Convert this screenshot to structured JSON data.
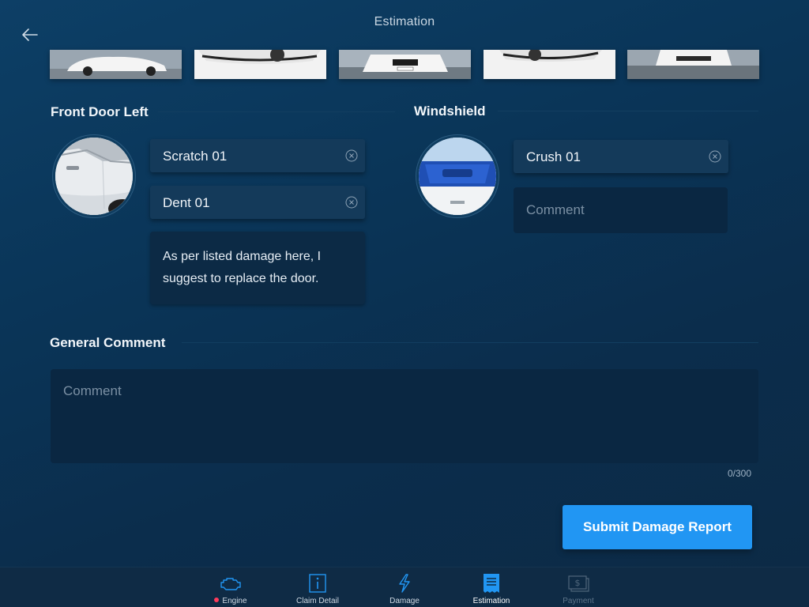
{
  "header": {
    "title": "Estimation"
  },
  "sections": {
    "front_door": {
      "title": "Front Door Left",
      "tags": [
        "Scratch 01",
        "Dent 01"
      ],
      "note": "As per listed damage here, I suggest to replace the door."
    },
    "windshield": {
      "title": "Windshield",
      "tags": [
        "Crush 01"
      ],
      "comment_placeholder": "Comment"
    }
  },
  "general_comment": {
    "title": "General Comment",
    "placeholder": "Comment",
    "counter": "0/300"
  },
  "submit_label": "Submit Damage Report",
  "tabs": [
    {
      "label": "Engine",
      "icon": "engine-icon",
      "state": "alert"
    },
    {
      "label": "Claim Detail",
      "icon": "info-icon",
      "state": "normal"
    },
    {
      "label": "Damage",
      "icon": "lightning-icon",
      "state": "normal"
    },
    {
      "label": "Estimation",
      "icon": "receipt-icon",
      "state": "active"
    },
    {
      "label": "Payment",
      "icon": "payment-icon",
      "state": "disabled"
    }
  ],
  "colors": {
    "accent": "#2196f3",
    "alert_dot": "#ff3b5c",
    "background": "#0b3354"
  }
}
